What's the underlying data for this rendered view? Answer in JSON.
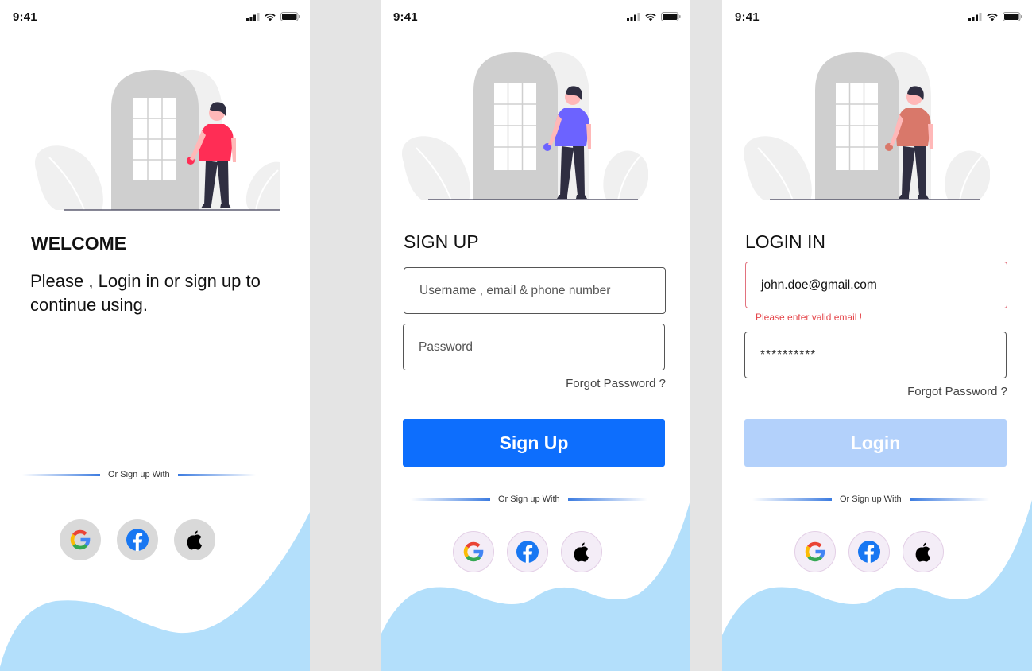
{
  "status": {
    "time": "9:41"
  },
  "colors": {
    "primary": "#0d6efd",
    "disabled": "#b3d1fb",
    "wave": "#b3dffb",
    "error": "#e5484d"
  },
  "welcome": {
    "title": "WELCOME",
    "message": "Please , Login in or sign up to continue using.",
    "divider": "Or  Sign up With",
    "shirt_color": "#ff2d55"
  },
  "signup": {
    "title": "SIGN UP",
    "username_placeholder": "Username , email & phone number",
    "password_placeholder": "Password",
    "forgot": "Forgot Password ?",
    "button": "Sign Up",
    "divider": "Or Sign up With",
    "shirt_color": "#6c63ff"
  },
  "login": {
    "title": "LOGIN IN",
    "email_value": "john.doe@gmail.com",
    "error": "Please enter valid email !",
    "password_value": "**********",
    "forgot": "Forgot Password ?",
    "button": "Login",
    "divider": "Or Sign up With",
    "shirt_color": "#d9786a"
  },
  "social": [
    {
      "icon": "google-icon"
    },
    {
      "icon": "facebook-icon"
    },
    {
      "icon": "apple-icon"
    }
  ]
}
